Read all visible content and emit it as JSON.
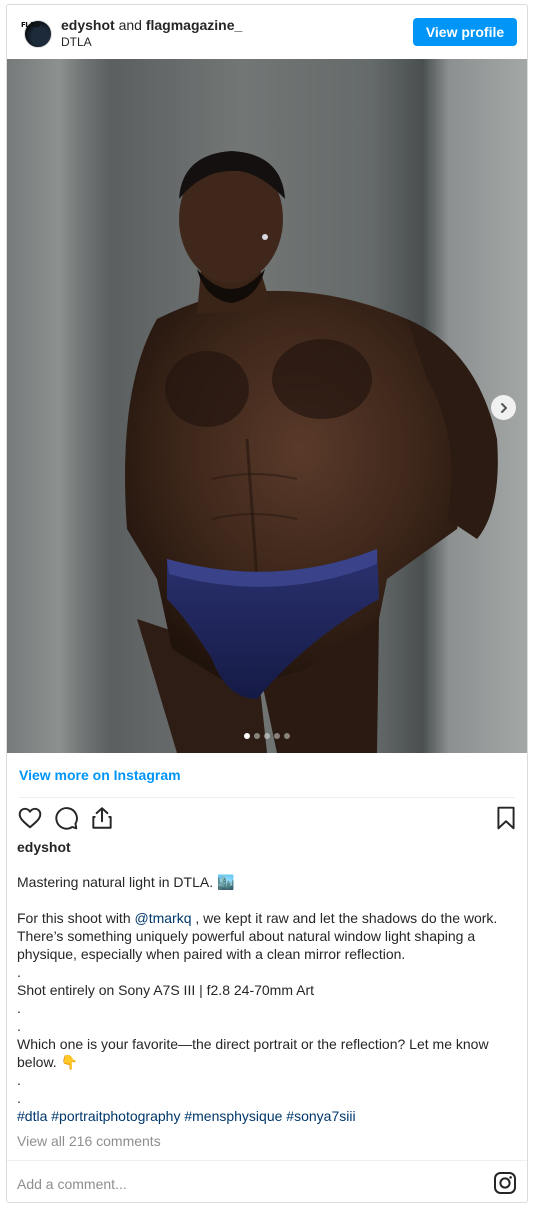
{
  "header": {
    "user1": "edyshot",
    "and": "and",
    "user2": "flagmagazine_",
    "location": "DTLA",
    "avatar_text": "FLAG",
    "view_profile": "View profile"
  },
  "carousel": {
    "slides": 5,
    "active": 1
  },
  "view_more": "View more on Instagram",
  "post": {
    "username": "edyshot",
    "caption": {
      "line1": "Mastering natural light in DTLA. 🏙️",
      "para_prefix": "For this shoot with ",
      "mention": "@tmarkq",
      "para_suffix": " , we kept it raw and let the shadows do the work. There’s something uniquely powerful about natural window light shaping a physique, especially when paired with a clean mirror reflection.",
      "dot": ".",
      "gear": "Shot entirely on Sony A7S III | f2.8 24-70mm Art",
      "question": "Which one is your favorite—the direct portrait or the reflection? Let me know below. 👇",
      "hashtags": [
        "#dtla",
        "#portraitphotography",
        "#mensphysique",
        "#sonya7siii"
      ]
    },
    "view_comments": "View all 216 comments",
    "add_comment_placeholder": "Add a comment..."
  },
  "colors": {
    "accent": "#0095f6",
    "link": "#00376b",
    "muted": "#8e8e8e"
  },
  "icons": [
    "heart-icon",
    "comment-icon",
    "share-icon",
    "bookmark-icon",
    "chevron-right-icon",
    "instagram-icon"
  ]
}
